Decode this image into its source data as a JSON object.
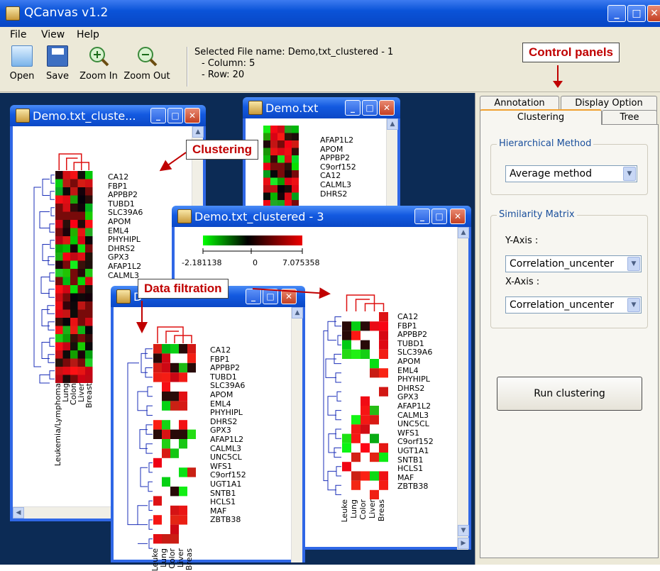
{
  "app": {
    "title": "QCanvas v1.2",
    "menu": [
      "File",
      "View",
      "Help"
    ],
    "toolbar": [
      "Open",
      "Save",
      "Zoom In",
      "Zoom Out"
    ],
    "file_info": {
      "selected": "Selected File name: Demo,txt_clustered - 1",
      "column": "- Column: 5",
      "row": "- Row: 20"
    }
  },
  "annotations": {
    "control_panels": "Control panels",
    "clustering": "Clustering",
    "data_filtration": "Data filtration"
  },
  "windows": {
    "w1": {
      "title": "Demo.txt_cluste...",
      "genes": [
        "CA12",
        "FBP1",
        "APPBP2",
        "TUBD1",
        "SLC39A6",
        "APOM",
        "EML4",
        "PHYHIPL",
        "DHRS2",
        "GPX3",
        "AFAP1L2",
        "CALML3"
      ],
      "columns": [
        "Leukemia/Lymphoma",
        "Lung",
        "Colon",
        "Liver",
        "Breast"
      ]
    },
    "w2": {
      "title": "Demo.txt",
      "genes": [
        "AFAP1L2",
        "APOM",
        "APPBP2",
        "C9orf152",
        "CA12",
        "CALML3",
        "DHRS2"
      ]
    },
    "w3": {
      "title": "Demo.txt_clustered - 3",
      "scale_min": "-2.181138",
      "scale_mid": "0",
      "scale_max": "7.075358",
      "genes": [
        "CA12",
        "FBP1",
        "APPBP2",
        "TUBD1",
        "SLC39A6",
        "APOM",
        "EML4",
        "PHYHIPL",
        "DHRS2",
        "GPX3",
        "AFAP1L2",
        "CALML3",
        "UNC5CL",
        "WFS1",
        "C9orf152",
        "UGT1A1",
        "SNTB1",
        "HCLS1",
        "MAF",
        "ZBTB38"
      ],
      "columns": [
        "Leuke",
        "Lung",
        "Color",
        "Liver",
        "Breas"
      ]
    },
    "w4": {
      "title": "D",
      "genes": [
        "CA12",
        "FBP1",
        "APPBP2",
        "TUBD1",
        "SLC39A6",
        "APOM",
        "EML4",
        "PHYHIPL",
        "DHRS2",
        "GPX3",
        "AFAP1L2",
        "CALML3",
        "UNC5CL",
        "WFS1",
        "C9orf152",
        "UGT1A1",
        "SNTB1",
        "HCLS1",
        "MAF",
        "ZBTB38"
      ],
      "columns": [
        "Leuke",
        "Lung",
        "Color",
        "Liver",
        "Breas"
      ]
    }
  },
  "panel": {
    "tabs_back": [
      "Annotation",
      "Display Option"
    ],
    "tabs_front": [
      "Clustering",
      "Tree"
    ],
    "hier_group": "Hierarchical Method",
    "hier_value": "Average method",
    "sim_group": "Similarity Matrix",
    "y_label": "Y-Axis :",
    "y_value": "Correlation_uncenter",
    "x_label": "X-Axis :",
    "x_value": "Correlation_uncenter",
    "run": "Run clustering"
  },
  "colors": {
    "red": "#e8201c",
    "green": "#2ed12c",
    "dark": "#1a0a08",
    "title_blue": "#0a53d8"
  }
}
